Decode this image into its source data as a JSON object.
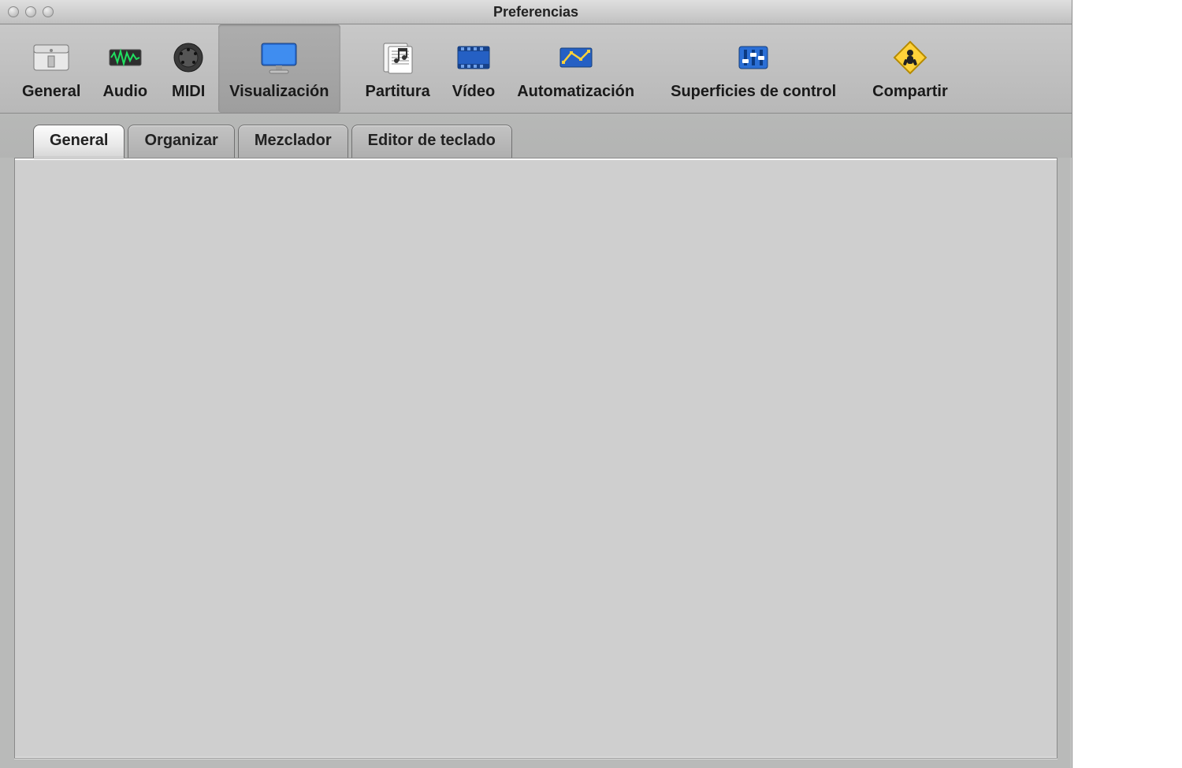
{
  "window": {
    "title": "Preferencias"
  },
  "toolbar": [
    {
      "id": "general",
      "label": "General",
      "icon": "general-icon",
      "selected": false
    },
    {
      "id": "audio",
      "label": "Audio",
      "icon": "audio-icon",
      "selected": false
    },
    {
      "id": "midi",
      "label": "MIDI",
      "icon": "midi-icon",
      "selected": false
    },
    {
      "id": "display",
      "label": "Visualización",
      "icon": "display-icon",
      "selected": true
    },
    {
      "id": "score",
      "label": "Partitura",
      "icon": "score-icon",
      "selected": false
    },
    {
      "id": "video",
      "label": "Vídeo",
      "icon": "video-icon",
      "selected": false
    },
    {
      "id": "automation",
      "label": "Automatización",
      "icon": "automation-icon",
      "selected": false
    },
    {
      "id": "surfaces",
      "label": "Superficies de control",
      "icon": "control-surfaces-icon",
      "selected": false
    },
    {
      "id": "share",
      "label": "Compartir",
      "icon": "share-icon",
      "selected": false
    }
  ],
  "tabs": [
    {
      "id": "general",
      "label": "General",
      "active": true
    },
    {
      "id": "arrange",
      "label": "Organizar",
      "active": false
    },
    {
      "id": "mixer",
      "label": "Mezclador",
      "active": false
    },
    {
      "id": "pianoroll",
      "label": "Editor de teclado",
      "active": false
    }
  ]
}
